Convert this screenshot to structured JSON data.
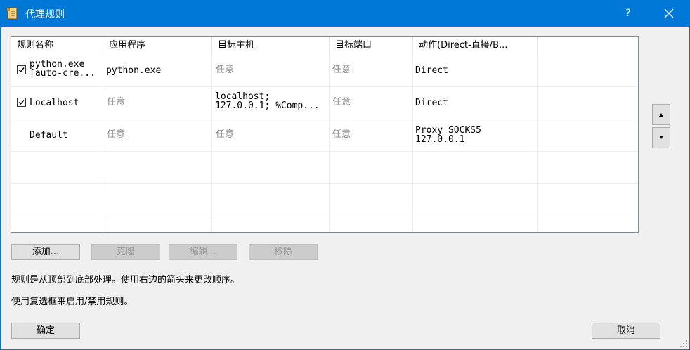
{
  "window": {
    "title": "代理规则",
    "help_label": "?"
  },
  "table": {
    "headers": [
      "规则名称",
      "应用程序",
      "目标主机",
      "目标端口",
      "动作(Direct-直接/B..."
    ],
    "rows": [
      {
        "checked": true,
        "name": "python.exe\n[auto-cre...",
        "application": "python.exe",
        "target_host": "任意",
        "target_port": "任意",
        "action": "Direct"
      },
      {
        "checked": true,
        "name": "Localhost",
        "application": "任意",
        "target_host": "localhost;\n127.0.0.1; %Comp...",
        "target_port": "任意",
        "action": "Direct"
      },
      {
        "checked": false,
        "name": "Default",
        "application": "任意",
        "target_host": "任意",
        "target_port": "任意",
        "action": "Proxy SOCKS5\n127.0.0.1"
      }
    ]
  },
  "buttons": {
    "add": "添加...",
    "clone": "克隆",
    "edit": "编辑...",
    "remove": "移除",
    "ok": "确定",
    "cancel": "取消"
  },
  "notes": {
    "order": "规则是从顶部到底部处理。使用右边的箭头来更改顺序。",
    "checkbox": "使用复选框来启用/禁用规则。"
  },
  "icons": {
    "app": "rules-scroll-icon",
    "close": "close-icon",
    "move_up": "arrow-up-icon",
    "move_down": "arrow-down-icon",
    "checkbox": "checkmark-icon",
    "resize": "resize-grip-icon"
  }
}
